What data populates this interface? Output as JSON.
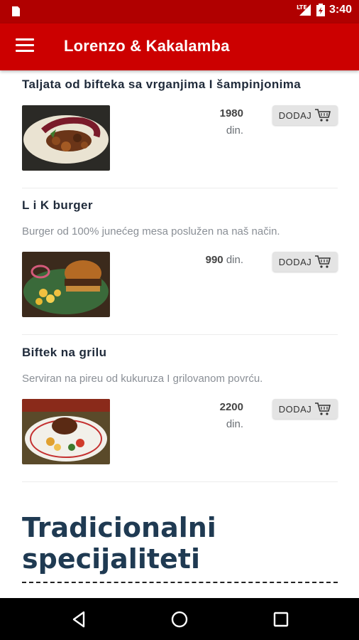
{
  "status_bar": {
    "time": "3:40",
    "network": "LTE"
  },
  "app_bar": {
    "title": "Lorenzo & Kakalamba"
  },
  "items": [
    {
      "name": "Taljata od bifteka sa vrganjima I šampinjonima",
      "description": "",
      "price_number": "1980",
      "price_unit": "din.",
      "add_label": "DODAJ",
      "image": "steak-with-mushrooms"
    },
    {
      "name": "L i K burger",
      "description": "Burger od 100% junećeg mesa poslužen na naš način.",
      "price_number": "990",
      "price_unit": "din.",
      "add_label": "DODAJ",
      "image": "burger-with-potatoes"
    },
    {
      "name": "Biftek na grilu",
      "description": "Serviran na pireu od kukuruza I grilovanom povrću.",
      "price_number": "2200",
      "price_unit": "din.",
      "add_label": "DODAJ",
      "image": "grilled-steak-plate"
    }
  ],
  "section": {
    "title": "Tradicionalni specijaliteti"
  },
  "colors": {
    "status_bar": "#b00000",
    "app_bar": "#cc0000",
    "section_title": "#1f3a52"
  },
  "icons": [
    "sim-card-icon",
    "signal-icon",
    "battery-icon",
    "menu-icon",
    "cart-icon",
    "back-icon",
    "home-icon",
    "recents-icon"
  ]
}
